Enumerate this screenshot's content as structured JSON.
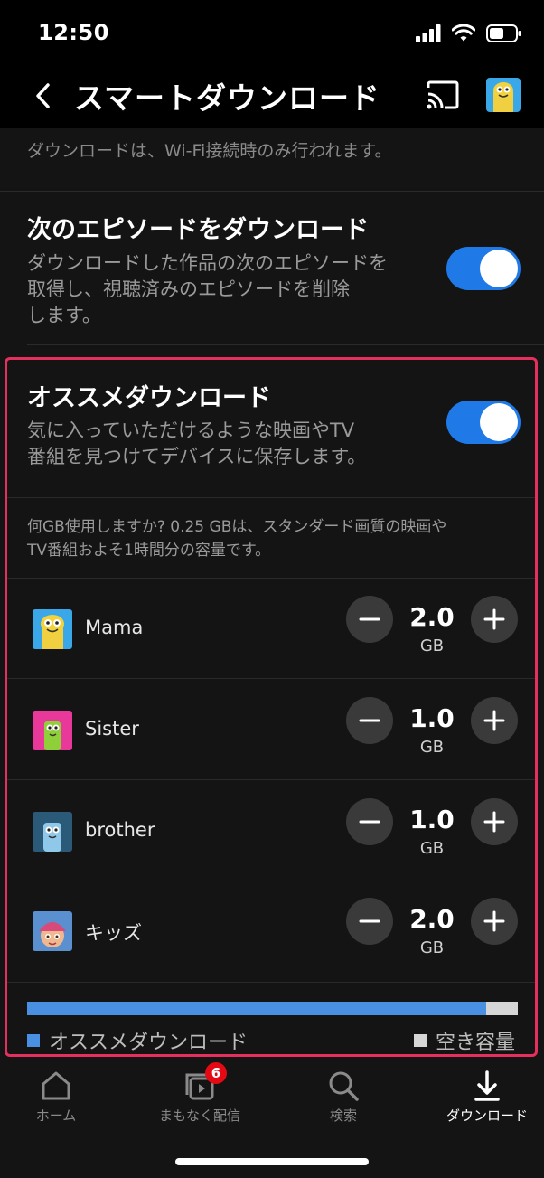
{
  "status": {
    "time": "12:50"
  },
  "header": {
    "title": "スマートダウンロード"
  },
  "partial_text": "ダウンロードは、Wi-Fi接続時のみ行われます。",
  "next_episode": {
    "title": "次のエピソードをダウンロード",
    "desc_lines": [
      "ダウンロードした作品の次のエピソードを",
      "取得し、視聴済みのエピソードを削除",
      "します。"
    ],
    "enabled": true
  },
  "recommended": {
    "title": "オススメダウンロード",
    "desc_lines": [
      "気に入っていただけるような映画やTV",
      "番組を見つけてデバイスに保存します。"
    ],
    "enabled": true
  },
  "usage_text": {
    "line1": "何GB使用しますか? 0.25 GBは、スタンダード画質の映画や",
    "line2": "TV番組およそ1時間分の容量です。"
  },
  "profiles": [
    {
      "name": "Mama",
      "amount": "2.0",
      "unit": "GB"
    },
    {
      "name": "Sister",
      "amount": "1.0",
      "unit": "GB"
    },
    {
      "name": "brother",
      "amount": "1.0",
      "unit": "GB"
    },
    {
      "name": "キッズ",
      "amount": "2.0",
      "unit": "GB"
    }
  ],
  "storage": {
    "used_fraction": 0.935,
    "used_label": "オススメダウンロード",
    "free_label": "空き容量",
    "used_color": "#4a90e2",
    "free_color": "#d6d6d6"
  },
  "nav": [
    {
      "label": "ホーム",
      "icon": "home-icon"
    },
    {
      "label": "まもなく配信",
      "icon": "coming-soon-icon",
      "badge": "6"
    },
    {
      "label": "検索",
      "icon": "search-icon"
    },
    {
      "label": "ダウンロード",
      "icon": "download-icon",
      "active": true
    }
  ],
  "colors": {
    "accent": "#1f7ae8",
    "highlight_border": "#e5305e",
    "badge": "#e50914"
  }
}
